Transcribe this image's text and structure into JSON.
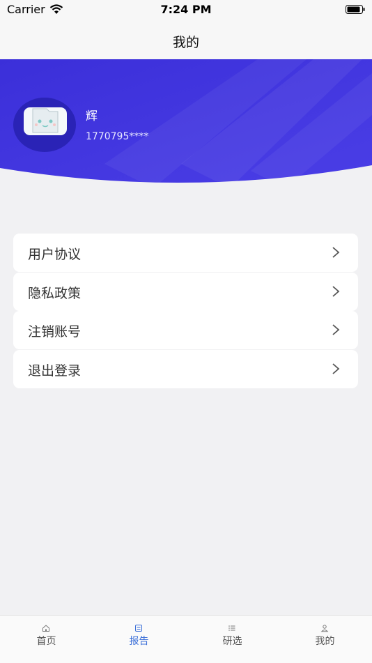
{
  "status_bar": {
    "carrier": "Carrier",
    "time": "7:24 PM"
  },
  "nav": {
    "title": "我的"
  },
  "profile": {
    "name": "辉",
    "phone": "1770795****"
  },
  "menu": {
    "items": [
      {
        "label": "用户协议"
      },
      {
        "label": "隐私政策"
      },
      {
        "label": "注销账号"
      },
      {
        "label": "退出登录"
      }
    ]
  },
  "tabs": {
    "items": [
      {
        "label": "首页",
        "icon": "home-icon"
      },
      {
        "label": "报告",
        "icon": "report-icon",
        "active": true
      },
      {
        "label": "研选",
        "icon": "list-icon"
      },
      {
        "label": "我的",
        "icon": "user-icon"
      }
    ]
  },
  "colors": {
    "header_blue": "#3d30db",
    "active_tab": "#3b6fd8"
  }
}
